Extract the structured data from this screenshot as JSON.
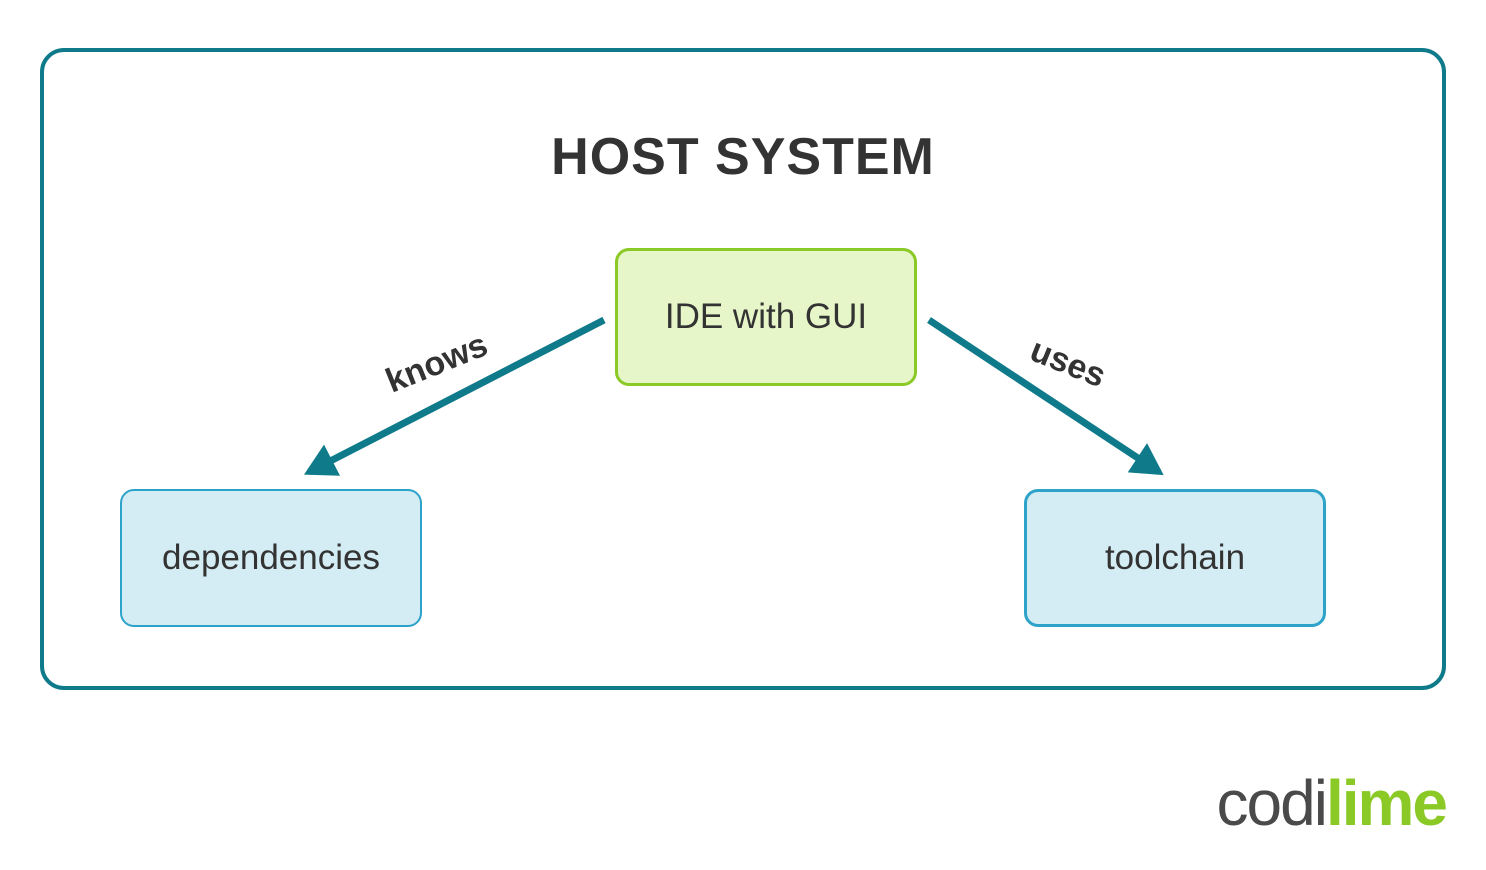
{
  "diagram": {
    "title": "HOST SYSTEM",
    "nodes": {
      "ide": {
        "label": "IDE with GUI",
        "color": "#e6f6c8",
        "border": "#8bc926"
      },
      "dependencies": {
        "label": "dependencies",
        "color": "#d4ecf3",
        "border": "#2ea3c9"
      },
      "toolchain": {
        "label": "toolchain",
        "color": "#d4ecf3",
        "border": "#2ea3c9"
      }
    },
    "edges": [
      {
        "from": "ide",
        "to": "dependencies",
        "label": "knows"
      },
      {
        "from": "ide",
        "to": "toolchain",
        "label": "uses"
      }
    ]
  },
  "branding": {
    "logo_part1": "codi",
    "logo_part2": "lime"
  },
  "colors": {
    "container_border": "#0e7a8a",
    "arrow": "#0e7a8a",
    "green_fill": "#e6f6c8",
    "green_border": "#8bc926",
    "blue_fill": "#d4ecf3",
    "blue_border": "#2ea3c9"
  }
}
